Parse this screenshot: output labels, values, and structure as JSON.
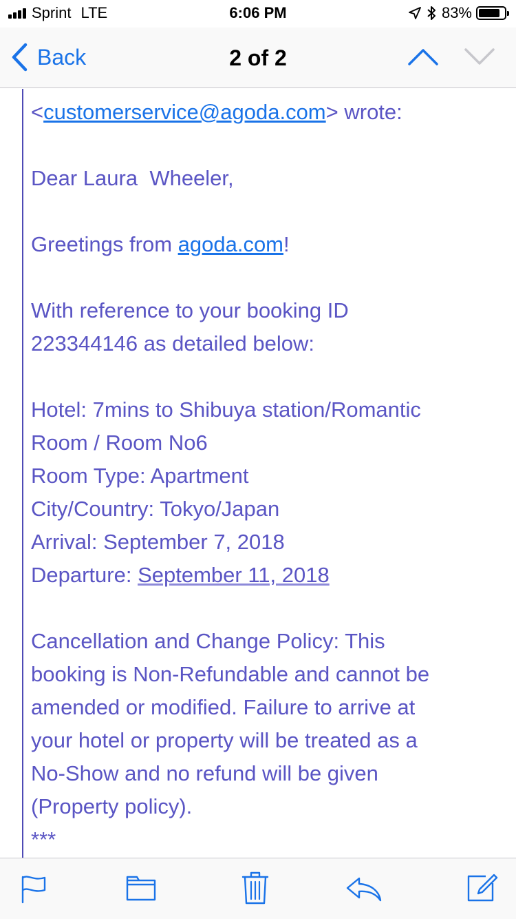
{
  "status_bar": {
    "carrier": "Sprint",
    "network": "LTE",
    "time": "6:06 PM",
    "battery_percent": "83%",
    "battery_level": 0.83,
    "icons": [
      "signal-bars-icon",
      "location-arrow-icon",
      "bluetooth-icon",
      "battery-icon"
    ]
  },
  "nav": {
    "back_label": "Back",
    "title": "2 of 2",
    "icons": [
      "chevron-left-icon",
      "chevron-up-icon",
      "chevron-down-icon"
    ]
  },
  "email": {
    "sender_prefix": "<",
    "sender_email": "customerservice@agoda.com",
    "sender_suffix": "> wrote:",
    "greeting": "Dear Laura  Wheeler,",
    "greetings_prefix": "Greetings from ",
    "greetings_link": "agoda.com",
    "greetings_suffix": "!",
    "reference_line1": "With reference to your booking ID",
    "reference_line2": "223344146 as detailed below:",
    "hotel_line1": "Hotel: 7mins to Shibuya station/Romantic",
    "hotel_line2": "Room / Room No6",
    "room_type": "Room Type: Apartment",
    "city_country": "City/Country: Tokyo/Japan",
    "arrival": "Arrival: September 7, 2018",
    "departure_label": "Departure: ",
    "departure_date": "September 11, 2018",
    "policy_lines": [
      "Cancellation and Change Policy: This",
      "booking is Non-Refundable and cannot be",
      "amended or modified. Failure to arrive at",
      "your hotel or property will be treated as a",
      "No-Show and no refund will be given",
      "(Property policy)."
    ],
    "separator": "***"
  },
  "toolbar": {
    "icons": [
      "flag-icon",
      "folder-icon",
      "trash-icon",
      "reply-icon",
      "compose-icon"
    ]
  },
  "colors": {
    "accent": "#1a73e8",
    "quoted_text": "#5a55c4",
    "quote_bar": "#4e4ab5"
  }
}
